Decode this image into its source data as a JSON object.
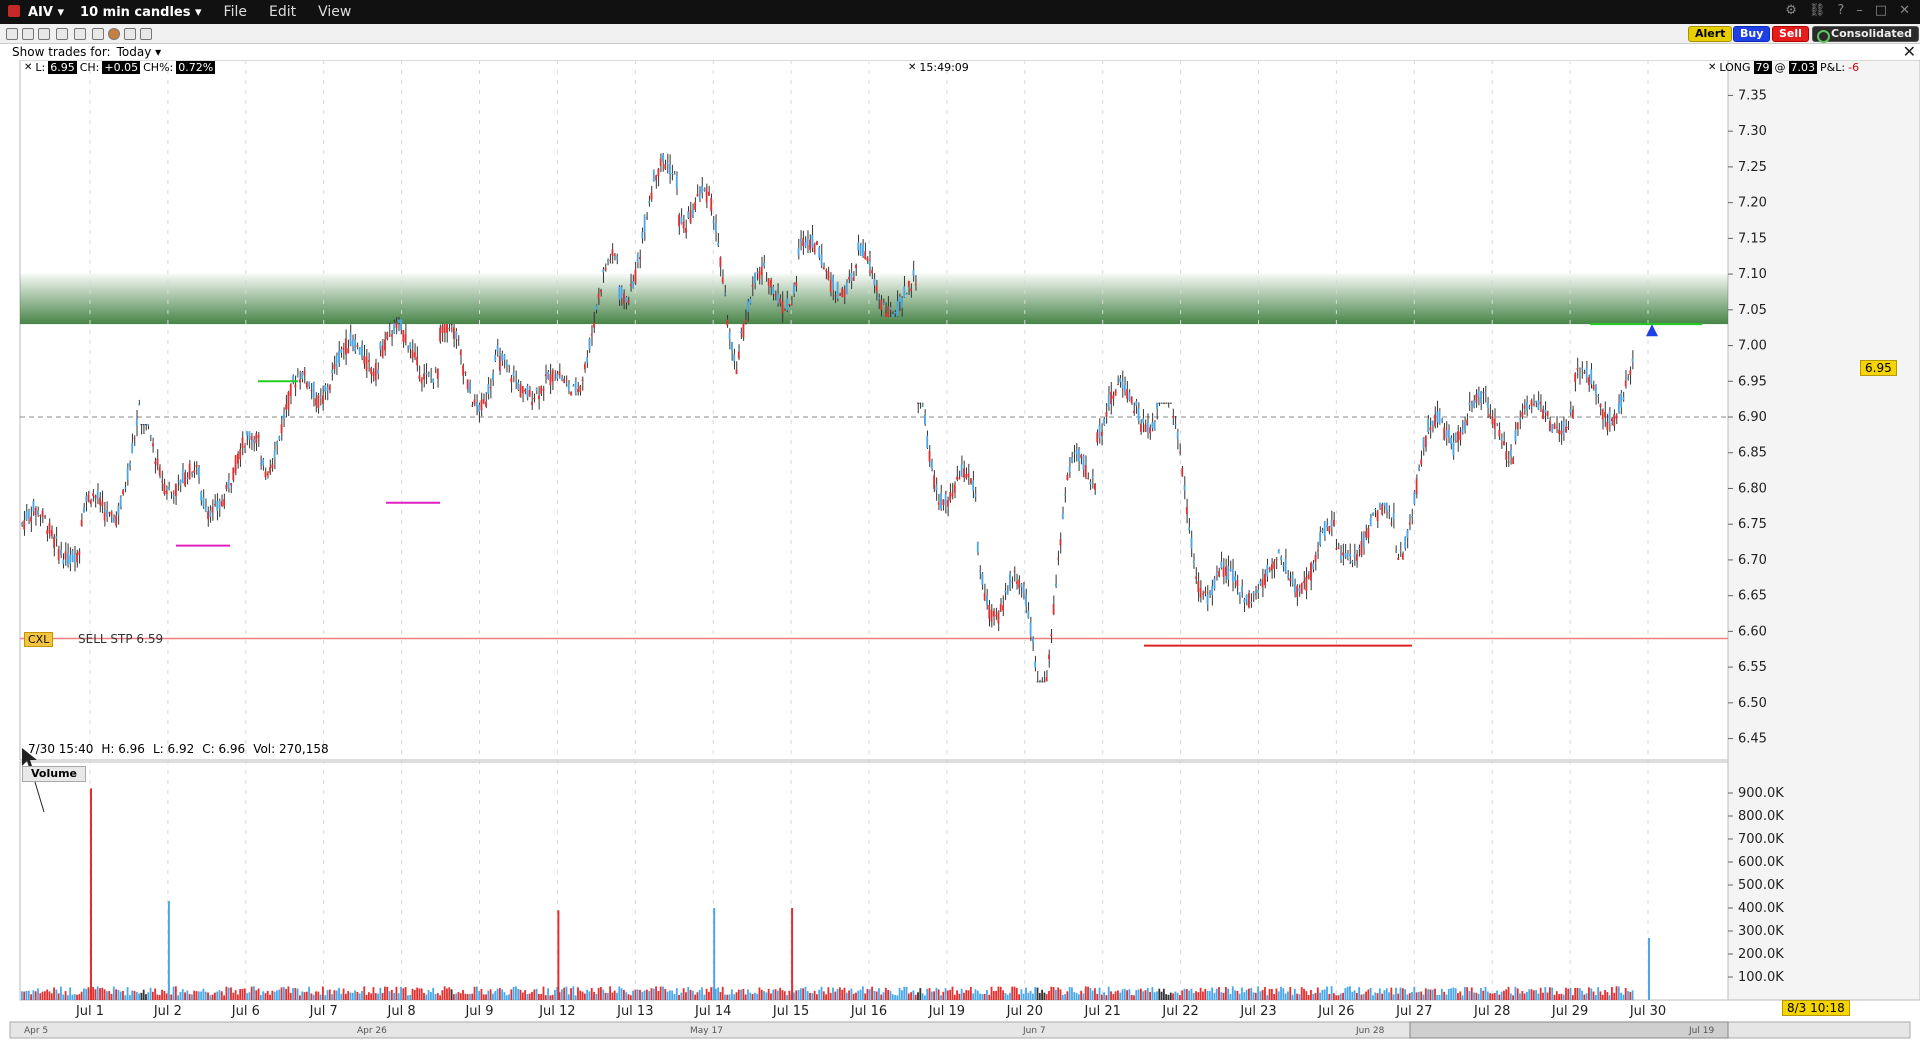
{
  "window": {
    "symbol": "AIV",
    "timeframe": "10 min candles",
    "menus": [
      "File",
      "Edit",
      "View"
    ]
  },
  "toolbar": {
    "alert_label": "Alert",
    "buy_label": "Buy",
    "sell_label": "Sell",
    "consolidated_label": "Consolidated",
    "show_trades_label": "Show trades for:",
    "show_trades_value": "Today"
  },
  "info": {
    "last_label": "L:",
    "last_value": "6.95",
    "change_label": "CH:",
    "change_value": "+0.05",
    "change_pct_label": "CH%:",
    "change_pct_value": "0.72%",
    "time": "15:49:09",
    "position_label": "LONG",
    "position_qty": "79",
    "position_at": "@",
    "position_price": "7.03",
    "pnl_label": "P&L:",
    "pnl_value": "-6"
  },
  "order": {
    "cxl_label": "CXL",
    "order_label": "SELL STP 6.59",
    "stop_price": 6.59
  },
  "hover_bar": {
    "date_time": "7/30 15:40",
    "high": "H: 6.96",
    "low": "L: 6.92",
    "close": "C: 6.96",
    "volume": "Vol: 270,158"
  },
  "volume_tab_label": "Volume",
  "last_price_tag": "6.95",
  "time_tag": "8/3 10:18",
  "colors": {
    "up": "#4aa8e8",
    "down": "#e03030",
    "neutral": "#333333",
    "resistance_zone": "#3e7e3e",
    "stop_line": "#f08080",
    "magenta": "#e020c0",
    "green_mark": "#22cc22",
    "red_mark": "#dd2222"
  },
  "chart_data": {
    "type": "candlestick",
    "price_axis": {
      "min": 6.42,
      "max": 7.38,
      "ticks": [
        "7.35",
        "7.30",
        "7.25",
        "7.20",
        "7.15",
        "7.10",
        "7.05",
        "7.00",
        "6.95",
        "6.90",
        "6.85",
        "6.80",
        "6.75",
        "6.70",
        "6.65",
        "6.60",
        "6.55",
        "6.50",
        "6.45"
      ]
    },
    "volume_axis": {
      "min": 0,
      "max": 1000000,
      "ticks": [
        "900.0K",
        "800.0K",
        "700.0K",
        "600.0K",
        "500.0K",
        "400.0K",
        "300.0K",
        "200.0K",
        "100.0K"
      ]
    },
    "dates": [
      "Jul 1",
      "Jul 2",
      "Jul 6",
      "Jul 7",
      "Jul 8",
      "Jul 9",
      "Jul 12",
      "Jul 13",
      "Jul 14",
      "Jul 15",
      "Jul 16",
      "Jul 19",
      "Jul 20",
      "Jul 21",
      "Jul 22",
      "Jul 23",
      "Jul 26",
      "Jul 27",
      "Jul 28",
      "Jul 29",
      "Jul 30"
    ],
    "navigator_labels": [
      "Apr 5",
      "Apr 26",
      "May 17",
      "Jun 7",
      "Jun 28",
      "Jul 19"
    ],
    "daily_path": [
      [
        6.75,
        6.8,
        6.68,
        6.72
      ],
      [
        6.72,
        6.93,
        6.7,
        6.88
      ],
      [
        6.88,
        6.89,
        6.72,
        6.78
      ],
      [
        6.78,
        6.88,
        6.74,
        6.86
      ],
      [
        6.86,
        6.97,
        6.78,
        6.95
      ],
      [
        6.95,
        7.04,
        6.9,
        7.0
      ],
      [
        7.0,
        7.04,
        6.9,
        6.98
      ],
      [
        6.98,
        7.03,
        6.78,
        6.96
      ],
      [
        6.96,
        7.0,
        6.91,
        6.94
      ],
      [
        6.94,
        7.15,
        6.93,
        7.1
      ],
      [
        7.1,
        7.29,
        7.05,
        7.25
      ],
      [
        7.25,
        7.29,
        6.96,
        7.02
      ],
      [
        7.02,
        7.19,
        6.98,
        7.12
      ],
      [
        7.12,
        7.19,
        7.04,
        7.1
      ],
      [
        7.1,
        7.2,
        7.04,
        7.06
      ],
      [
        6.91,
        6.92,
        6.64,
        6.73
      ],
      [
        6.73,
        6.78,
        6.47,
        6.55
      ],
      [
        6.55,
        6.94,
        6.53,
        6.9
      ],
      [
        6.9,
        7.02,
        6.85,
        6.92
      ],
      [
        6.91,
        6.92,
        6.6,
        6.66
      ],
      [
        6.66,
        6.72,
        6.61,
        6.68
      ],
      [
        6.68,
        6.78,
        6.62,
        6.72
      ],
      [
        6.72,
        6.78,
        6.65,
        6.75
      ],
      [
        6.75,
        6.95,
        6.7,
        6.9
      ],
      [
        6.9,
        7.0,
        6.83,
        6.88
      ],
      [
        6.88,
        6.95,
        6.8,
        6.92
      ],
      [
        6.92,
        7.07,
        6.87,
        6.95
      ]
    ],
    "volume_spikes": [
      {
        "date_index": 0,
        "value": 920000
      },
      {
        "date_index": 1,
        "value": 430000
      },
      {
        "date_index": 6,
        "value": 390000
      },
      {
        "date_index": 8,
        "value": 400000
      },
      {
        "date_index": 9,
        "value": 400000
      },
      {
        "date_index": 20,
        "value": 270000
      }
    ],
    "annotations": [
      {
        "type": "zone",
        "from": 7.03,
        "to": 7.1,
        "color": "green"
      },
      {
        "type": "hline",
        "price": 6.59,
        "color": "pink",
        "label": "SELL STP 6.59"
      },
      {
        "type": "hline",
        "price": 6.9,
        "style": "dashed",
        "color": "gray"
      },
      {
        "type": "segment",
        "price": 6.72,
        "color": "magenta"
      },
      {
        "type": "segment",
        "price": 6.78,
        "color": "magenta"
      },
      {
        "type": "segment",
        "price": 6.95,
        "color": "green"
      },
      {
        "type": "segment",
        "price": 6.58,
        "color": "red"
      },
      {
        "type": "segment",
        "price": 7.03,
        "color": "green"
      },
      {
        "type": "marker",
        "shape": "triangle-up",
        "price": 7.02,
        "color": "blue"
      }
    ]
  }
}
